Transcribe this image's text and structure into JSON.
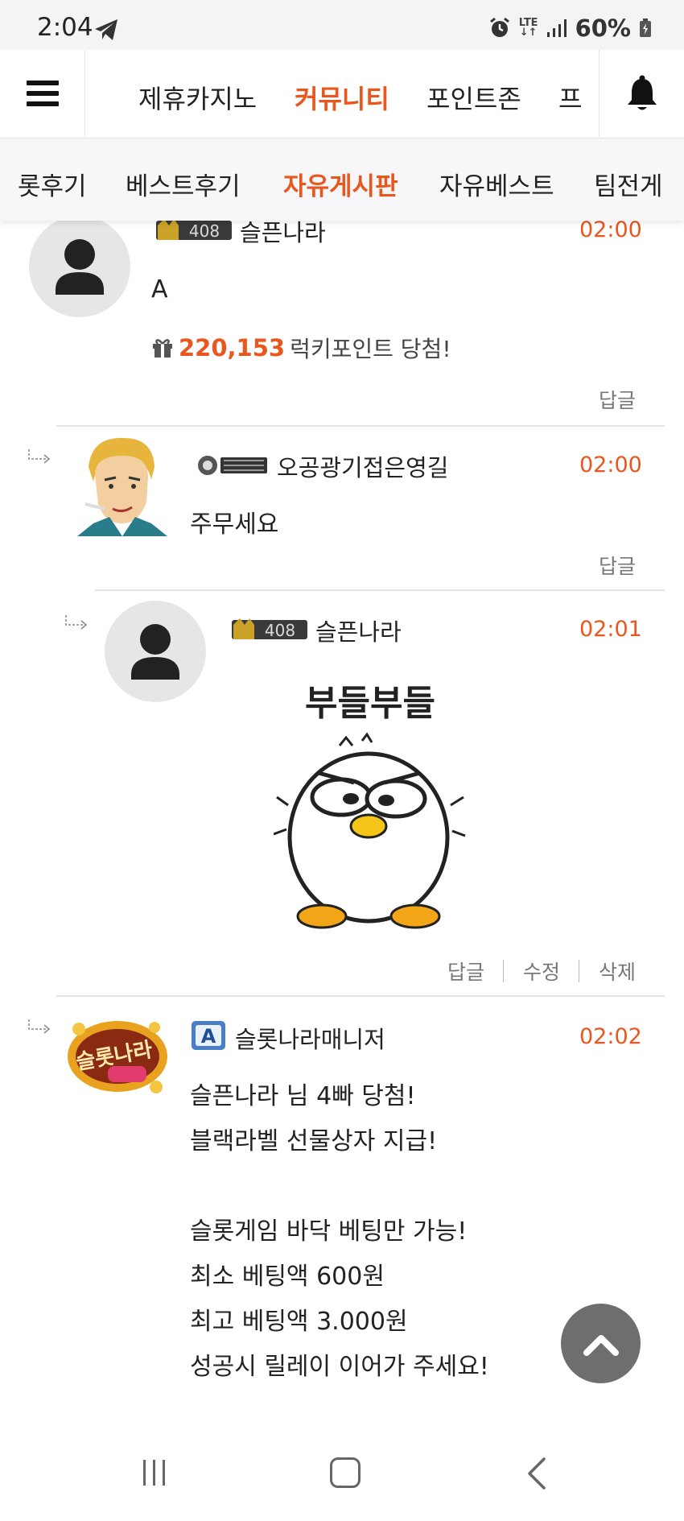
{
  "status_bar": {
    "time": "2:04",
    "lte_top": "LTE",
    "lte_bottom": "↓↑",
    "battery": "60%"
  },
  "header": {
    "tabs": [
      {
        "label": "제휴카지노",
        "active": false
      },
      {
        "label": "커뮤니티",
        "active": true
      },
      {
        "label": "포인트존",
        "active": false
      },
      {
        "label": "프",
        "active": false
      }
    ]
  },
  "sub_nav": {
    "tabs": [
      {
        "label": "롯후기",
        "active": false
      },
      {
        "label": "베스트후기",
        "active": false
      },
      {
        "label": "자유게시판",
        "active": true
      },
      {
        "label": "자유베스트",
        "active": false
      },
      {
        "label": "팀전게",
        "active": false
      }
    ]
  },
  "comments": [
    {
      "nickname": "슬픈나라",
      "level": "408",
      "time": "02:00",
      "text": "A",
      "lucky_points": "220,153",
      "lucky_label": "럭키포인트 당첨!",
      "actions": [
        "답글"
      ]
    },
    {
      "nickname": "오공광기접은영길",
      "time": "02:00",
      "text": "주무세요",
      "actions": [
        "답글"
      ]
    },
    {
      "nickname": "슬픈나라",
      "level": "408",
      "time": "02:01",
      "sticker_text": "부들부들",
      "actions": [
        "답글",
        "수정",
        "삭제"
      ]
    },
    {
      "nickname": "슬롯나라매니저",
      "badge_letter": "A",
      "time": "02:02",
      "lines": [
        "슬픈나라 님 4빠 당첨!",
        "블랙라벨 선물상자 지급!",
        "",
        "슬롯게임 바닥 베팅만 가능!",
        "최소 베팅액 600원",
        "최고 베팅액 3.000원",
        "성공시 릴레이 이어가 주세요!"
      ],
      "avatar_logo_text": "슬롯나라"
    }
  ],
  "icons": {
    "menu": "hamburger-icon",
    "bell": "bell-icon",
    "gift": "gift-icon",
    "reply": "reply-arrow-icon",
    "scroll_top": "chevron-up-icon"
  },
  "colors": {
    "accent": "#e8571e",
    "scroll_button": "#6e6e6e",
    "avatar_bg": "#e6e6e6"
  }
}
